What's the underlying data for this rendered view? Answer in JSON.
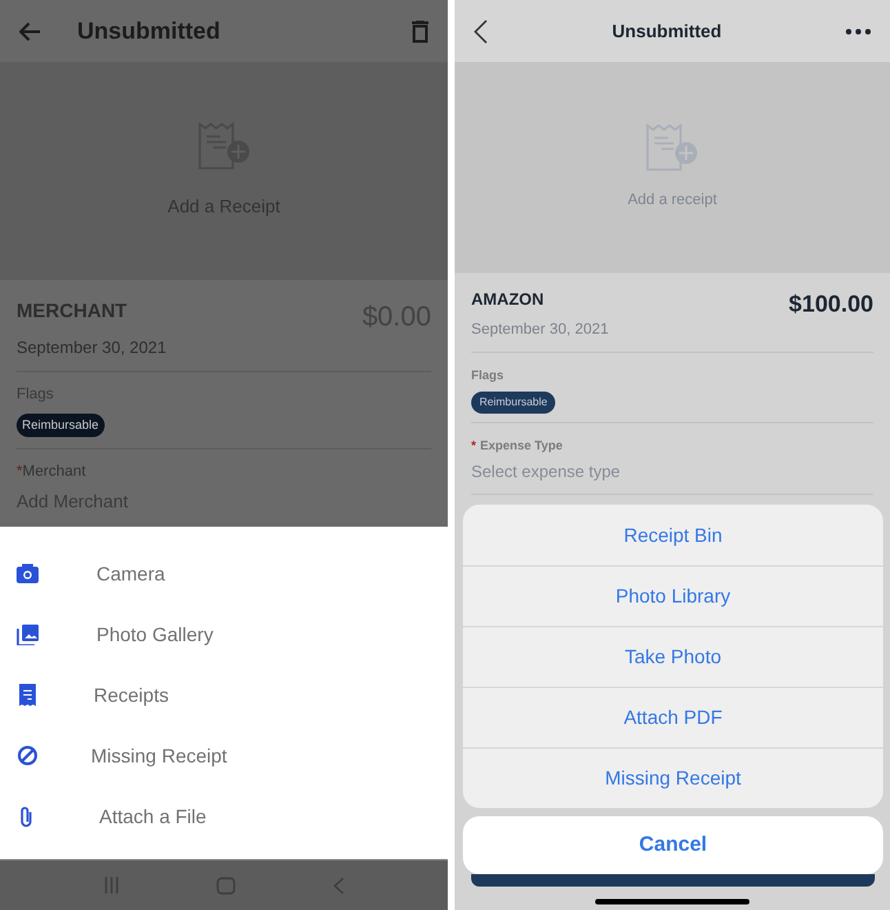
{
  "android": {
    "title": "Unsubmitted",
    "receipt_prompt": "Add a Receipt",
    "merchant": "MERCHANT",
    "amount": "$0.00",
    "date": "September 30, 2021",
    "flags_label": "Flags",
    "flags": [
      "Reimbursable"
    ],
    "field": {
      "label": "Merchant",
      "required": true,
      "required_mark": "*",
      "placeholder": "Add Merchant"
    },
    "sheet_items": [
      {
        "kind": "camera",
        "label": "Camera"
      },
      {
        "kind": "gallery",
        "label": "Photo Gallery"
      },
      {
        "kind": "receipts",
        "label": "Receipts"
      },
      {
        "kind": "missing",
        "label": "Missing Receipt"
      },
      {
        "kind": "attach",
        "label": "Attach a File"
      }
    ]
  },
  "ios": {
    "title": "Unsubmitted",
    "receipt_prompt": "Add a receipt",
    "merchant": "AMAZON",
    "amount": "$100.00",
    "date": "September 30, 2021",
    "flags_label": "Flags",
    "flags": [
      "Reimbursable"
    ],
    "field": {
      "label": "Expense Type",
      "required": true,
      "required_mark": "*",
      "placeholder": "Select expense type"
    },
    "actions": [
      "Receipt Bin",
      "Photo Library",
      "Take Photo",
      "Attach PDF",
      "Missing Receipt"
    ],
    "cancel": "Cancel"
  }
}
